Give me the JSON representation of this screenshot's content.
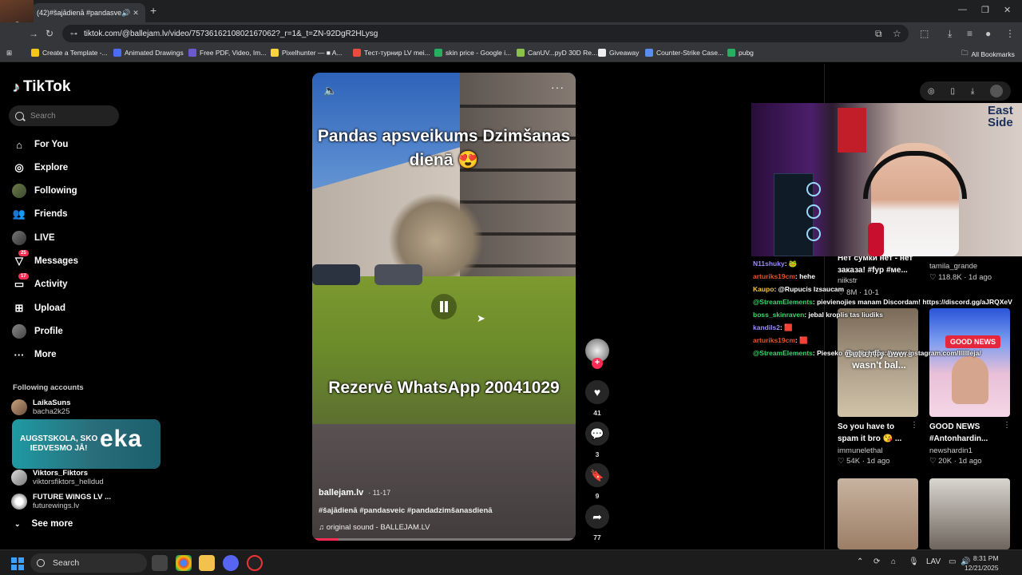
{
  "browser": {
    "tab_title": "(42)#šajādienā #pandasveic",
    "stream_tag": "x3",
    "url": "tiktok.com/@ballejam.lv/video/7573616210802167062?_r=1&_t=ZN-92DgR2HLysg",
    "bookmarks": [
      {
        "label": "Create a Template -...",
        "color": "#f5c518"
      },
      {
        "label": "Animated Drawings",
        "color": "#4a6cf7"
      },
      {
        "label": "Free PDF, Video, Im...",
        "color": "#6a5acd"
      },
      {
        "label": "Pixelhunter — ■ A...",
        "color": "#ffd23f"
      },
      {
        "label": "Тест-турнир LV mei...",
        "color": "#e74c3c"
      },
      {
        "label": "skin price - Google i...",
        "color": "#27ae60"
      },
      {
        "label": "CanUV...pyD 30D Re...",
        "color": "#8bc34a"
      },
      {
        "label": "Giveaway",
        "color": "#eeeeee"
      },
      {
        "label": "Counter-Strike Case...",
        "color": "#5b8def"
      },
      {
        "label": "pubg",
        "color": "#27ae60"
      }
    ],
    "all_bookmarks": "All Bookmarks"
  },
  "sidebar": {
    "logo": "TikTok",
    "search_placeholder": "Search",
    "nav": [
      {
        "label": "For You",
        "icon": "home-icon"
      },
      {
        "label": "Explore",
        "icon": "compass-icon"
      },
      {
        "label": "Following",
        "icon": "avatar-icon"
      },
      {
        "label": "Friends",
        "icon": "friends-icon"
      },
      {
        "label": "LIVE",
        "icon": "live-icon"
      },
      {
        "label": "Messages",
        "icon": "messages-icon",
        "badge": "25"
      },
      {
        "label": "Activity",
        "icon": "activity-icon",
        "badge": "17"
      },
      {
        "label": "Upload",
        "icon": "upload-icon"
      },
      {
        "label": "Profile",
        "icon": "profile-icon"
      },
      {
        "label": "More",
        "icon": "more-icon"
      }
    ],
    "following_title": "Following accounts",
    "following": [
      {
        "name": "LaikaSuns",
        "user": "bacha2k25"
      },
      {
        "name": "Viktors_Fiktors",
        "user": "viktorsfiktors_helldud"
      },
      {
        "name": "FUTURE WINGS LV ...",
        "user": "futurewings.lv"
      }
    ],
    "banner_left": "AUGSTSKOLA, SKO\nIEDVESMO JĀ!",
    "banner_right": "eka",
    "see_more": "See more"
  },
  "video": {
    "caption_top": "Pandas apsveikums Dzimšanas dienā 😍",
    "caption_bottom": "Rezervē WhatsApp 20041029",
    "author": "ballejam.lv",
    "date": "· 11-17",
    "tags": "#šajādienā #pandasveic #pandadzimšanasdienā",
    "sound": "♫ original sound - BALLEJAM.LV",
    "progress": 0.1
  },
  "actions": {
    "likes": "41",
    "comments": "3",
    "saves": "9",
    "shares": "77"
  },
  "chat": [
    {
      "user": "N11shuky",
      "msg": ": 🐸",
      "cls": "u"
    },
    {
      "user": "arturiks19cm",
      "msg": ": hehe",
      "cls": "u2"
    },
    {
      "user": "Kaupo",
      "msg": ": @Rupucis Izsaucam",
      "cls": "u3"
    },
    {
      "user": "@StreamElements",
      "msg": ": pievienojies manam Discordam! https://discord.gg/aJRQXeV",
      "cls": "u4"
    },
    {
      "user": "boss_skinraven",
      "msg": ": jebal kroplis tas liudiks",
      "cls": "u4"
    },
    {
      "user": "kandils2",
      "msg": ": 🟥",
      "cls": "u"
    },
    {
      "user": "arturiks19cm",
      "msg": ": 🟥",
      "cls": "u2"
    },
    {
      "user": "@StreamElements",
      "msg": ": Pieseko man ig https://www.instagram.com/lllllleja/",
      "cls": "u4"
    }
  ],
  "feed": {
    "top_cards": [
      {
        "title": "Нет сумки нет - нет заказа! #fyp #ме...",
        "user": "niikstr",
        "meta": "♡ 8M · 10-1"
      },
      {
        "title": "",
        "user": "tamila_grande",
        "meta": "♡ 118.8K · 1d ago"
      }
    ],
    "cards": [
      {
        "overlay": "Butterfly users wasn't bal...",
        "title": "So you have to spam it bro 😘 ...",
        "user": "immunelethal",
        "meta": "♡ 54K · 1d ago"
      },
      {
        "overlay": "GOOD NEWS",
        "title": "GOOD NEWS #Antonhardin...",
        "user": "newshardin1",
        "meta": "♡ 20K · 1d ago"
      }
    ]
  },
  "taskbar": {
    "search": "Search",
    "lang": "LAV",
    "time": "8:31 PM",
    "date": "12/21/2025"
  }
}
